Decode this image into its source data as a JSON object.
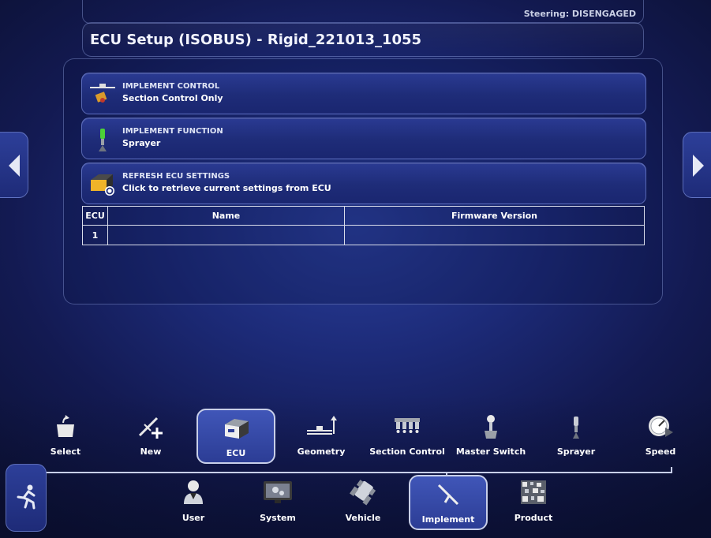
{
  "status": {
    "steering": "Steering: DISENGAGED"
  },
  "page": {
    "title": "ECU Setup (ISOBUS) - Rigid_221013_1055"
  },
  "settings": [
    {
      "title": "IMPLEMENT CONTROL",
      "value": "Section Control Only",
      "icon": "implement-control-icon"
    },
    {
      "title": "IMPLEMENT FUNCTION",
      "value": "Sprayer",
      "icon": "implement-function-icon"
    },
    {
      "title": "REFRESH ECU SETTINGS",
      "value": "Click to retrieve current settings from ECU",
      "icon": "refresh-ecu-icon"
    }
  ],
  "ecu_table": {
    "headers": [
      "ECU",
      "Name",
      "Firmware Version"
    ],
    "rows": [
      [
        "1",
        "",
        ""
      ]
    ]
  },
  "tabs": [
    {
      "label": "Select",
      "icon": "select-icon"
    },
    {
      "label": "New",
      "icon": "new-icon"
    },
    {
      "label": "ECU",
      "icon": "ecu-icon",
      "selected": true
    },
    {
      "label": "Geometry",
      "icon": "geometry-icon"
    },
    {
      "label": "Section Control",
      "icon": "section-control-icon"
    },
    {
      "label": "Master Switch",
      "icon": "master-switch-icon"
    },
    {
      "label": "Sprayer",
      "icon": "sprayer-icon"
    },
    {
      "label": "Speed",
      "icon": "speed-icon"
    }
  ],
  "categories": [
    {
      "label": "User",
      "icon": "user-icon"
    },
    {
      "label": "System",
      "icon": "system-icon"
    },
    {
      "label": "Vehicle",
      "icon": "vehicle-icon"
    },
    {
      "label": "Implement",
      "icon": "implement-icon",
      "selected": true
    },
    {
      "label": "Product",
      "icon": "product-icon"
    }
  ],
  "colors": {
    "background": "#1c2a77",
    "button": "#1e2c78",
    "selected_tab": "#3a4fb0",
    "text": "#ffffff"
  }
}
